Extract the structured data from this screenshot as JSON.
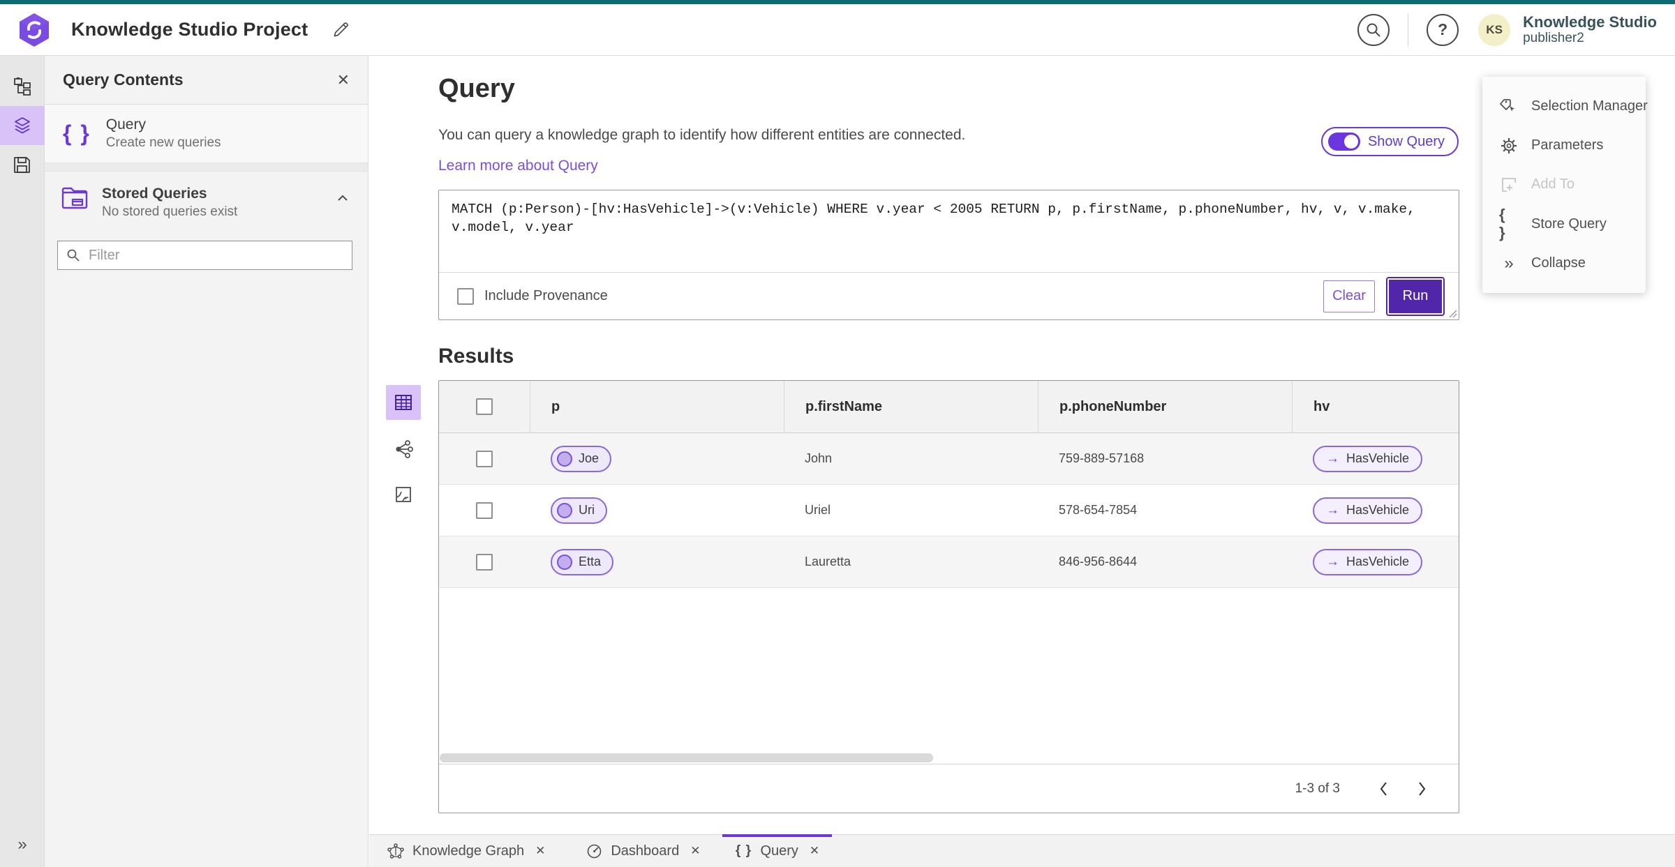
{
  "colors": {
    "accent_purple": "#6b38d6",
    "run_button": "#5226a8",
    "selected_rail_bg": "#d9c2f8",
    "top_strip_teal": "#0d6c70",
    "avatar_bg": "#f3efc9",
    "pill_bg": "#eee8fb"
  },
  "icons": {
    "help": "?",
    "close": "✕",
    "arrow_right": "→",
    "double_chevron_right": "»",
    "braces": "{ }"
  },
  "header": {
    "title": "Knowledge Studio Project",
    "product": "Knowledge Studio",
    "username": "publisher2",
    "avatar_initials": "KS"
  },
  "panel": {
    "title": "Query Contents",
    "query_item": {
      "label": "Query",
      "sublabel": "Create new queries"
    },
    "stored": {
      "label": "Stored Queries",
      "sublabel": "No stored queries exist"
    },
    "filter_placeholder": "Filter"
  },
  "main": {
    "heading": "Query",
    "description": "You can query a knowledge graph to identify how different entities are connected.",
    "learn_more": "Learn more about Query",
    "show_query_label": "Show Query",
    "query_text": "MATCH (p:Person)-[hv:HasVehicle]->(v:Vehicle) WHERE v.year < 2005 RETURN p, p.firstName, p.phoneNumber, hv, v, v.make, v.model, v.year",
    "include_provenance_label": "Include Provenance",
    "clear_label": "Clear",
    "run_label": "Run",
    "results_heading": "Results"
  },
  "table": {
    "columns": [
      "p",
      "p.firstName",
      "p.phoneNumber",
      "hv"
    ],
    "rows": [
      {
        "p": "Joe",
        "firstName": "John",
        "phoneNumber": "759-889-57168",
        "hv": "HasVehicle"
      },
      {
        "p": "Uri",
        "firstName": "Uriel",
        "phoneNumber": "578-654-7854",
        "hv": "HasVehicle"
      },
      {
        "p": "Etta",
        "firstName": "Lauretta",
        "phoneNumber": "846-956-8644",
        "hv": "HasVehicle"
      }
    ],
    "pagination": {
      "label": "1-3 of 3"
    }
  },
  "context_menu": {
    "items": [
      {
        "label": "Selection Manager"
      },
      {
        "label": "Parameters"
      },
      {
        "label": "Add To"
      },
      {
        "label": "Store Query"
      },
      {
        "label": "Collapse"
      }
    ]
  },
  "tabs": [
    {
      "label": "Knowledge Graph"
    },
    {
      "label": "Dashboard"
    },
    {
      "label": "Query"
    }
  ]
}
